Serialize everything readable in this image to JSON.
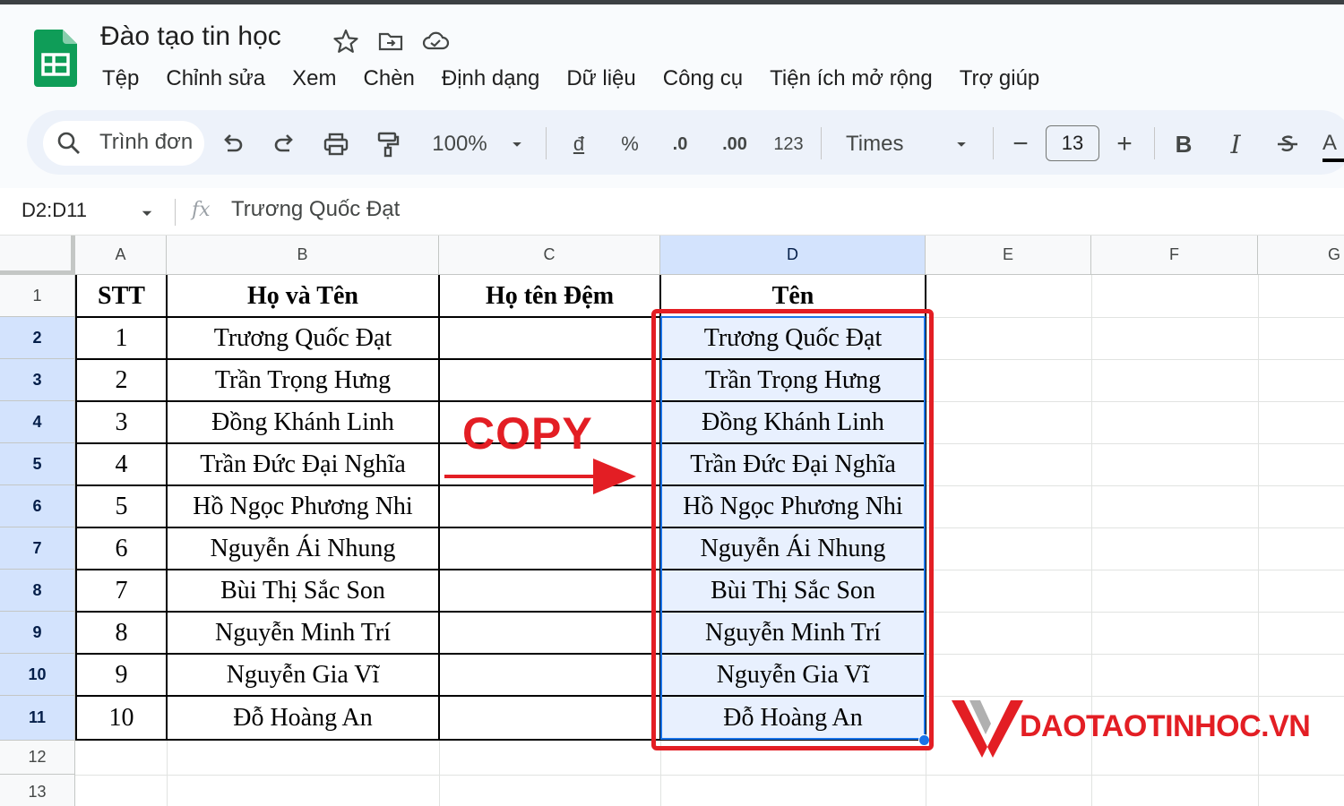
{
  "app": {
    "doc_title": "Đào tạo tin học",
    "menu": [
      "Tệp",
      "Chỉnh sửa",
      "Xem",
      "Chèn",
      "Định dạng",
      "Dữ liệu",
      "Công cụ",
      "Tiện ích mở rộng",
      "Trợ giúp"
    ]
  },
  "toolbar": {
    "search_text": "Trình đơn",
    "zoom": "100%",
    "currency": "đ",
    "percent": "%",
    "dec_decrease": ".0",
    "dec_increase": ".00",
    "number_format": "123",
    "font": "Times",
    "minus": "−",
    "font_size": "13",
    "plus": "+",
    "bold": "B",
    "italic": "I",
    "text_color": "A"
  },
  "formula_bar": {
    "name_box": "D2:D11",
    "fx": "fx",
    "value": "Trương Quốc Đạt"
  },
  "sheet": {
    "columns": [
      "A",
      "B",
      "C",
      "D",
      "E",
      "F",
      "G"
    ],
    "rows": [
      "1",
      "2",
      "3",
      "4",
      "5",
      "6",
      "7",
      "8",
      "9",
      "10",
      "11",
      "12",
      "13"
    ],
    "headers": {
      "stt": "STT",
      "full_name": "Họ và Tên",
      "middle": "Họ tên Đệm",
      "first": "Tên"
    },
    "data": [
      {
        "stt": "1",
        "full_name": "Trương Quốc Đạt",
        "d": "Trương Quốc Đạt"
      },
      {
        "stt": "2",
        "full_name": "Trần Trọng Hưng",
        "d": "Trần Trọng Hưng"
      },
      {
        "stt": "3",
        "full_name": "Đồng Khánh Linh",
        "d": "Đồng Khánh Linh"
      },
      {
        "stt": "4",
        "full_name": "Trần Đức Đại Nghĩa",
        "d": "Trần Đức Đại Nghĩa"
      },
      {
        "stt": "5",
        "full_name": "Hồ Ngọc Phương Nhi",
        "d": "Hồ Ngọc Phương Nhi"
      },
      {
        "stt": "6",
        "full_name": "Nguyễn Ái Nhung",
        "d": "Nguyễn Ái Nhung"
      },
      {
        "stt": "7",
        "full_name": "Bùi Thị Sắc Son",
        "d": "Bùi Thị Sắc Son"
      },
      {
        "stt": "8",
        "full_name": "Nguyễn Minh Trí",
        "d": "Nguyễn Minh Trí"
      },
      {
        "stt": "9",
        "full_name": "Nguyễn Gia Vĩ",
        "d": "Nguyễn Gia Vĩ"
      },
      {
        "stt": "10",
        "full_name": "Đỗ Hoàng An",
        "d": "Đỗ Hoàng An"
      }
    ]
  },
  "annotation": {
    "copy_label": "COPY",
    "color": "#e31e24"
  },
  "watermark": {
    "text": "DAOTAOTINHOC.VN"
  },
  "colors": {
    "accent": "#1a73e8",
    "selection_header": "#d3e3fd",
    "sheets_green": "#0f9d58"
  }
}
